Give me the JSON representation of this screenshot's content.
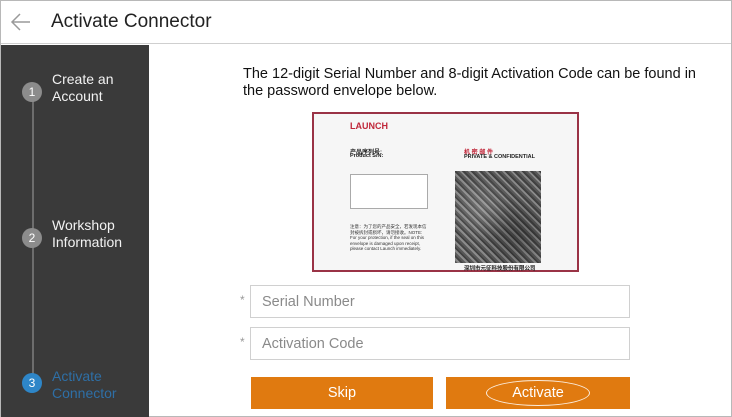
{
  "header": {
    "title": "Activate Connector",
    "back_icon": "arrow-left-icon"
  },
  "sidebar": {
    "steps": [
      {
        "number": "1",
        "label_line1": "Create an",
        "label_line2": "Account",
        "state": "done"
      },
      {
        "number": "2",
        "label_line1": "Workshop",
        "label_line2": "Information",
        "state": "done"
      },
      {
        "number": "3",
        "label_line1": "Activate",
        "label_line2": "Connector",
        "state": "active"
      }
    ]
  },
  "main": {
    "intro": "The 12-digit Serial Number and 8-digit Activation Code can be found in the password envelope below.",
    "envelope": {
      "brand": "LAUNCH",
      "sn_cn": "产品序列号:",
      "sn_en": "Product S/N:",
      "private_cn": "机 密 邮 件",
      "private_en": "PRIVATE & CONFIDENTIAL",
      "note": "注意：为了您的产品安全，若发现本信封被拆封或损坏，请勿接收。NOTE: For your protection, if the seal on this envelope is damaged upon receipt, please contact Launch immediately.",
      "company": "深圳市元征科技股份有限公司"
    },
    "fields": {
      "required_mark": "*",
      "serial_placeholder": "Serial Number",
      "serial_value": "",
      "activation_placeholder": "Activation Code",
      "activation_value": ""
    },
    "buttons": {
      "skip": "Skip",
      "activate": "Activate"
    }
  },
  "colors": {
    "accent": "#e07a10",
    "sidebar_bg": "#3a3a3a",
    "active_step": "#2e86c8",
    "envelope_border": "#9a3346"
  }
}
